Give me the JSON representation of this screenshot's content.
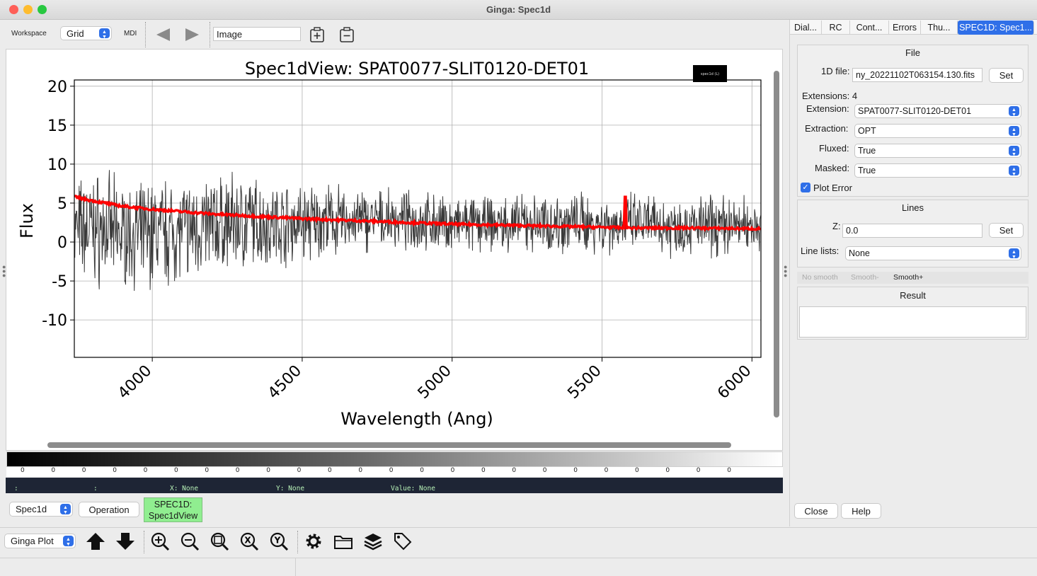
{
  "window": {
    "title": "Ginga: Spec1d"
  },
  "toolbar": {
    "workspace_label": "Workspace",
    "workspace_value": "Grid",
    "mdi_label": "MDI",
    "name_input": "Image"
  },
  "right_tabs": [
    "Dial...",
    "RC",
    "Cont...",
    "Errors",
    "Thu...",
    "SPEC1D: Spec1..."
  ],
  "file_group": {
    "title": "File",
    "file_label": "1D file:",
    "file_value": "ny_20221102T063154.130.fits",
    "set_label": "Set",
    "extensions_text": "Extensions: 4",
    "extension_label": "Extension:",
    "extension_value": "SPAT0077-SLIT0120-DET01",
    "extraction_label": "Extraction:",
    "extraction_value": "OPT",
    "fluxed_label": "Fluxed:",
    "fluxed_value": "True",
    "masked_label": "Masked:",
    "masked_value": "True",
    "plot_error_label": "Plot Error",
    "plot_error_checked": true
  },
  "lines_group": {
    "title": "Lines",
    "z_label": "Z:",
    "z_value": "0.0",
    "set_label": "Set",
    "linelists_label": "Line lists:",
    "linelists_value": "None"
  },
  "smooth_tabs": [
    "No smooth",
    "Smooth-",
    "Smooth+"
  ],
  "result_group": {
    "title": "Result"
  },
  "right_buttons": {
    "close": "Close",
    "help": "Help"
  },
  "colorbar_ticks": [
    "0",
    "0",
    "0",
    "0",
    "0",
    "0",
    "0",
    "0",
    "0",
    "0",
    "0",
    "0",
    "0",
    "0",
    "0",
    "0",
    "0",
    "0",
    "0",
    "0",
    "0",
    "0",
    "0",
    "0"
  ],
  "status": {
    "a": ":",
    "b": ":",
    "x": "X: None",
    "y": "Y: None",
    "value": "Value: None"
  },
  "channel": {
    "select": "Spec1d",
    "operation": "Operation",
    "plugin_tag": "SPEC1D:\nSpec1dView"
  },
  "bottom": {
    "select": "Ginga Plot"
  },
  "colors": {
    "error": "#ff0000",
    "flux": "#3a3a3a",
    "accent": "#2f6fe8",
    "plugin_tag": "#90ee90"
  },
  "chart_data": {
    "type": "line",
    "title": "Spec1dView: SPAT0077-SLIT0120-DET01",
    "xlabel": "Wavelength (Ang)",
    "ylabel": "Flux",
    "xlim": [
      3740,
      6030
    ],
    "ylim": [
      -14.8,
      20.8
    ],
    "xticks": [
      "4000",
      "4500",
      "5000",
      "5500",
      "6000"
    ],
    "xtick_values": [
      4000,
      4500,
      5000,
      5500,
      6000
    ],
    "yticks": [
      "20",
      "15",
      "10",
      "5",
      "0",
      "-5",
      "-10"
    ],
    "ytick_values": [
      20,
      15,
      10,
      5,
      0,
      -5,
      -10
    ],
    "grid": true,
    "legend_label": "spec1d (L)",
    "legend_placement": "top-right",
    "series": [
      {
        "name": "flux",
        "color": "#3a3a3a",
        "x": [
          3740,
          3800,
          3860,
          3900,
          3960,
          4000,
          4100,
          4200,
          4300,
          4400,
          4500,
          4600,
          4700,
          4800,
          4900,
          5000,
          5200,
          5400,
          5600,
          5800,
          6030
        ],
        "y": [
          1.5,
          1.8,
          1.2,
          1.0,
          0.8,
          1.2,
          1.5,
          2.2,
          2.5,
          2.4,
          2.4,
          2.6,
          2.7,
          2.8,
          2.6,
          2.2,
          2.2,
          2.5,
          2.3,
          2.0,
          2.3
        ],
        "amplitude": [
          6,
          7,
          7,
          6,
          6,
          7,
          6,
          6,
          6,
          5,
          5,
          4.5,
          4,
          3.5,
          3.5,
          3.5,
          3.5,
          3.8,
          3.8,
          3.8,
          3.5
        ]
      },
      {
        "name": "error",
        "color": "#ff0000",
        "x": [
          3740,
          3800,
          3900,
          4000,
          4200,
          4500,
          5000,
          5500,
          5600,
          5800,
          6030
        ],
        "y": [
          5.8,
          5.3,
          4.6,
          4.2,
          3.6,
          3.0,
          2.3,
          1.9,
          1.8,
          1.8,
          1.7
        ]
      }
    ]
  }
}
